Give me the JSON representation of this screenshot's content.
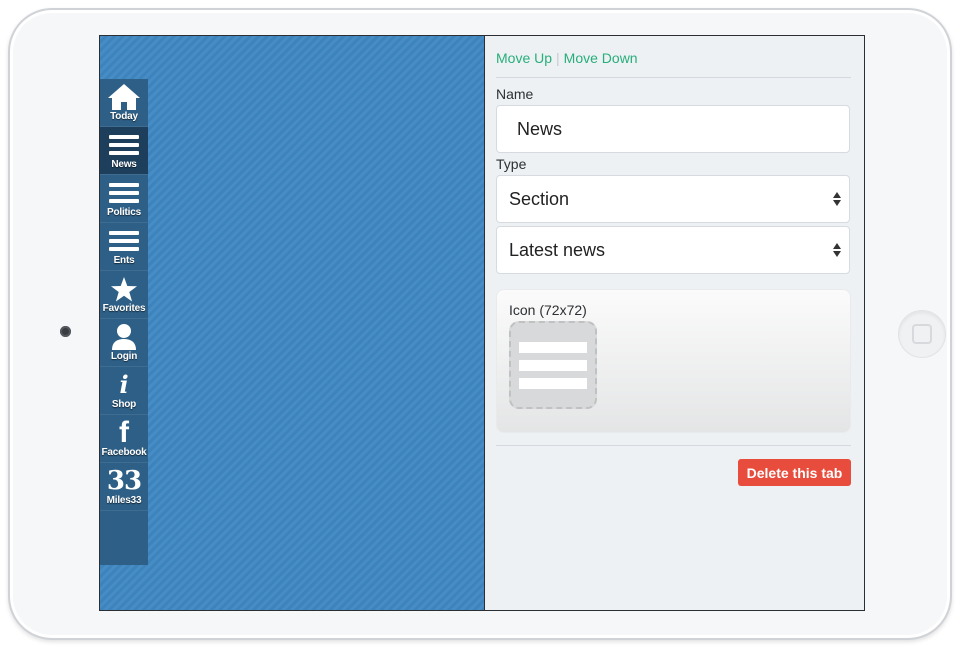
{
  "tabs": [
    {
      "label": "Today",
      "icon": "home-icon"
    },
    {
      "label": "News",
      "icon": "list-icon",
      "active": true
    },
    {
      "label": "Politics",
      "icon": "list-icon"
    },
    {
      "label": "Ents",
      "icon": "list-icon"
    },
    {
      "label": "Favorites",
      "icon": "star-icon"
    },
    {
      "label": "Login",
      "icon": "user-icon"
    },
    {
      "label": "Shop",
      "icon": "info-icon"
    },
    {
      "label": "Facebook",
      "icon": "facebook-icon"
    },
    {
      "label": "Miles33",
      "icon": "miles33-logo",
      "logo_text": "33"
    }
  ],
  "editor": {
    "move_up": "Move Up",
    "move_separator": "|",
    "move_down": "Move Down",
    "name_label": "Name",
    "name_value": "News",
    "type_label": "Type",
    "type_value": "Section",
    "section_value": "Latest news",
    "icon_label": "Icon (72x72)",
    "delete_label": "Delete this tab"
  },
  "colors": {
    "preview_bg": "#3f87c2",
    "tabbar_bg": "#2e5f86",
    "link_green": "#27ae7a",
    "delete_red": "#e74c3c"
  }
}
